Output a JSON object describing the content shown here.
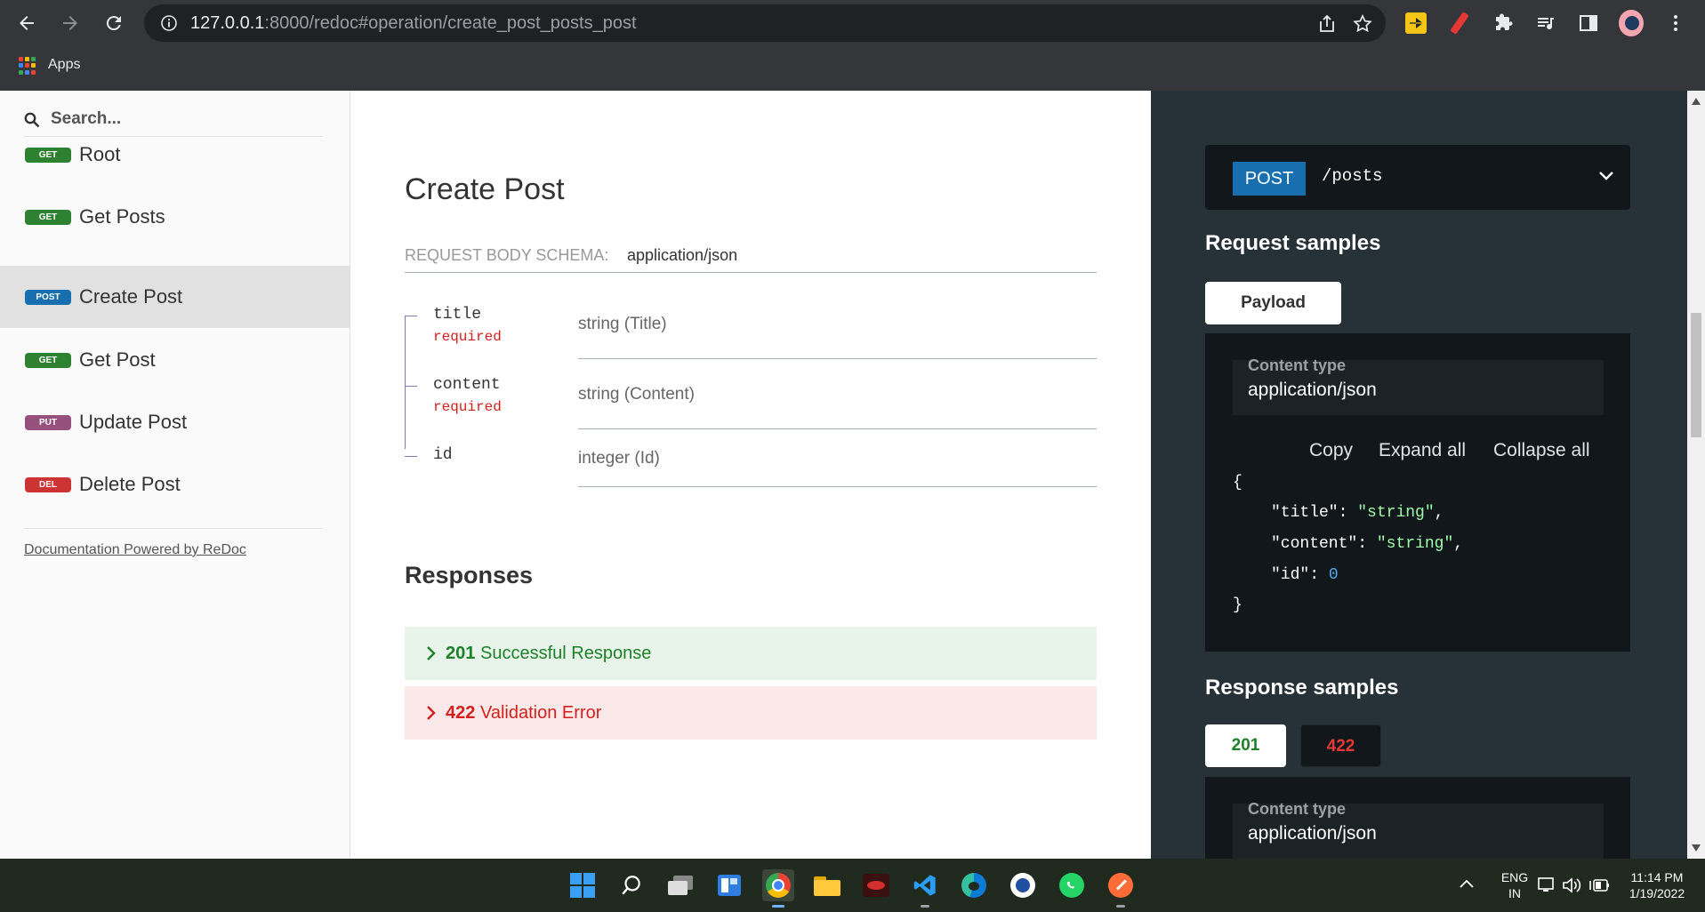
{
  "browser": {
    "url_host": "127.0.0.1",
    "url_rest": ":8000/redoc#operation/create_post_posts_post",
    "bookmarks_label": "Apps"
  },
  "sidebar": {
    "search_placeholder": "Search...",
    "items": [
      {
        "method": "GET",
        "label": "Root"
      },
      {
        "method": "GET",
        "label": "Get Posts"
      },
      {
        "method": "POST",
        "label": "Create Post"
      },
      {
        "method": "GET",
        "label": "Get Post"
      },
      {
        "method": "PUT",
        "label": "Update Post"
      },
      {
        "method": "DEL",
        "label": "Delete Post"
      }
    ],
    "powered_by": "Documentation Powered by ReDoc"
  },
  "operation": {
    "title": "Create Post",
    "schema_label": "REQUEST BODY SCHEMA:",
    "schema_type": "application/json",
    "properties": [
      {
        "name": "title",
        "required": "required",
        "type": "string (Title)"
      },
      {
        "name": "content",
        "required": "required",
        "type": "string (Content)"
      },
      {
        "name": "id",
        "required": "",
        "type": "integer (Id)"
      }
    ],
    "responses_title": "Responses",
    "responses": [
      {
        "code": "201",
        "text": "Successful Response"
      },
      {
        "code": "422",
        "text": "Validation Error"
      }
    ]
  },
  "right_panel": {
    "method": "POST",
    "path": "/posts",
    "request_title": "Request samples",
    "payload_tab": "Payload",
    "content_type_label": "Content type",
    "content_type_value": "application/json",
    "copy": "Copy",
    "expand_all": "Expand all",
    "collapse_all": "Collapse all",
    "code": {
      "open": "{",
      "k1": "\"title\"",
      "v1": "\"string\"",
      "k2": "\"content\"",
      "v2": "\"string\"",
      "k3": "\"id\"",
      "v3": "0",
      "close": "}"
    },
    "response_title": "Response samples",
    "response_tabs": [
      "201",
      "422"
    ],
    "response_content_type_label": "Content type",
    "response_content_type_value": "application/json"
  },
  "taskbar": {
    "lang_line1": "ENG",
    "lang_line2": "IN",
    "time": "11:14 PM",
    "date": "1/19/2022"
  },
  "colors": {
    "get": "#2f8132",
    "post": "#186faf",
    "put": "#95507c",
    "del": "#cc3333",
    "right_bg": "#263238"
  }
}
